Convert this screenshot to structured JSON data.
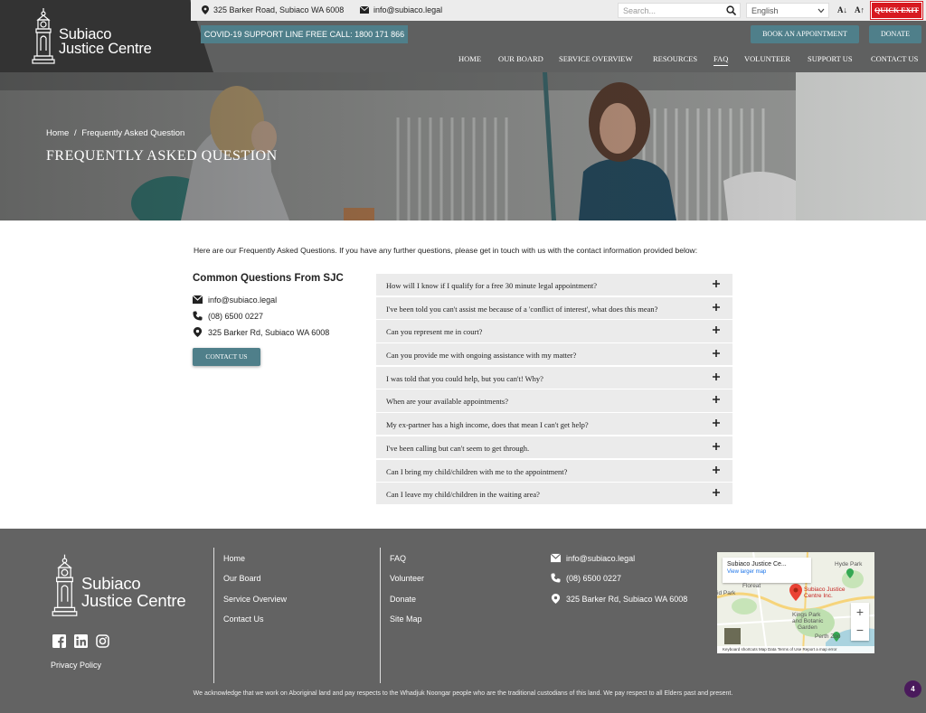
{
  "brand": {
    "line1": "Subiaco",
    "line2": "Justice Centre"
  },
  "topbar": {
    "address": "325 Barker Road, Subiaco WA 6008",
    "email": "info@subiaco.legal",
    "search_placeholder": "Search...",
    "language": "English",
    "font_decrease": "A↓",
    "font_increase": "A↑",
    "quick_exit": "QUICK EXIT"
  },
  "covid_line": "COVID-19 SUPPORT LINE FREE CALL: 1800 171 866",
  "buttons": {
    "book": "BOOK AN APPOINTMENT",
    "donate": "DONATE"
  },
  "nav": [
    "HOME",
    "OUR BOARD",
    "SERVICE OVERVIEW",
    "RESOURCES",
    "FAQ",
    "VOLUNTEER",
    "SUPPORT US",
    "CONTACT US"
  ],
  "nav_active": "FAQ",
  "hero": {
    "breadcrumb_home": "Home",
    "breadcrumb_sep": "/",
    "breadcrumb_current": "Frequently Asked Question",
    "title": "FREQUENTLY ASKED QUESTION"
  },
  "intro": "Here are our Frequently Asked Questions. If you have any further questions, please get in touch with us with the contact information provided below:",
  "sidebar": {
    "heading": "Common Questions From SJC",
    "email": "info@subiaco.legal",
    "phone": "(08) 6500 0227",
    "address": "325 Barker Rd, Subiaco WA 6008",
    "contact_button": "CONTACT US"
  },
  "faq": [
    "How will I know if I qualify for a free 30 minute legal appointment?",
    "I've been told you can't assist me because of a 'conflict of interest', what does this mean?",
    "Can you represent me in court?",
    "Can you provide me with ongoing assistance with my matter?",
    "I was told that you could help, but you can't! Why?",
    "When are your available appointments?",
    "My ex-partner has a high income, does that mean I can't get help?",
    "I've been calling but can't seem to get through.",
    "Can I bring my child/children with me to the appointment?",
    "Can I leave my child/children in the waiting area?"
  ],
  "footer": {
    "privacy": "Privacy Policy",
    "col1": [
      "Home",
      "Our Board",
      "Service Overview",
      "Contact Us"
    ],
    "col2": [
      "FAQ",
      "Volunteer",
      "Donate",
      "Site Map"
    ],
    "email": "info@subiaco.legal",
    "phone": "(08) 6500 0227",
    "address": "325 Barker Rd, Subiaco WA 6008",
    "map": {
      "title": "Subiaco Justice Ce...",
      "link": "View larger map",
      "pin_label_1": "Subiaco Justice",
      "pin_label_2": "Centre Inc.",
      "labels": [
        "Hyde Park",
        "Floreat",
        "Kings Park",
        "and Botanic",
        "Garden",
        "Perth Zoo",
        "id Park"
      ],
      "attribution": "Keyboard shortcuts   Map Data   Terms of Use   Report a map error"
    },
    "acknowledgement": "We acknowledge that we work on Aboriginal land and pay respects to the Whadjuk Noongar people who are the traditional custodians of this land. We pay respect to all Elders past and present."
  },
  "badge_count": "4"
}
